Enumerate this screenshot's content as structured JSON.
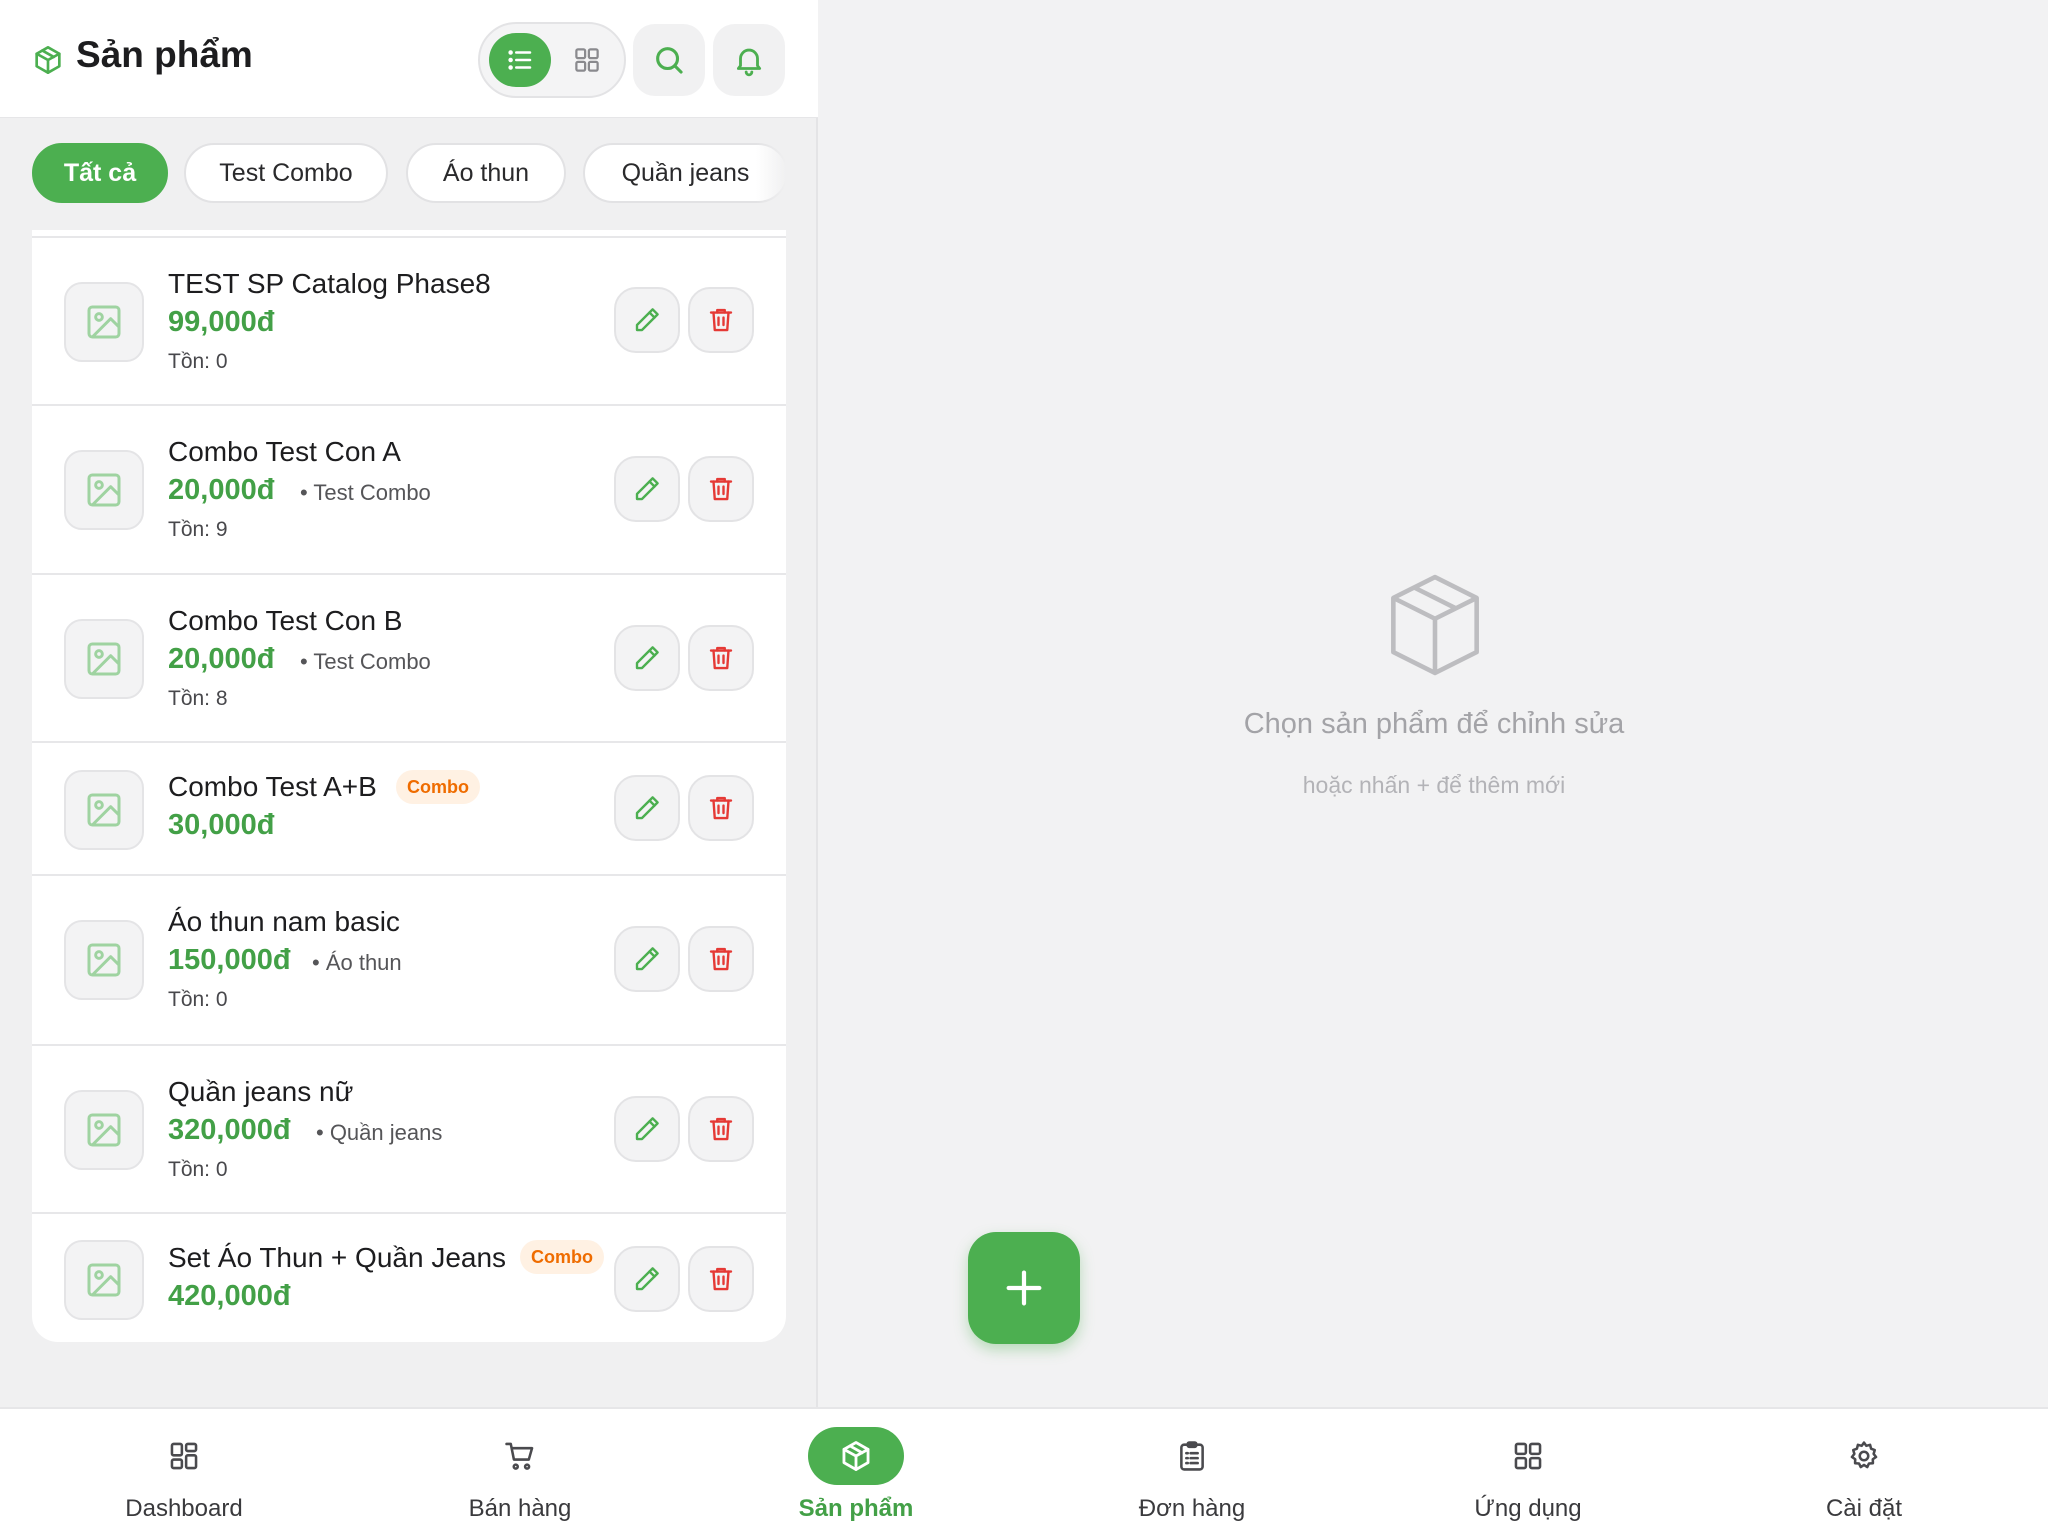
{
  "header": {
    "title": "Sản phẩm",
    "logo_icon": "box-icon",
    "view_list_icon": "list-icon",
    "view_grid_icon": "grid-icon",
    "search_icon": "search-icon",
    "bell_icon": "bell-icon"
  },
  "chips": [
    {
      "label": "Tất cả",
      "active": true
    },
    {
      "label": "Test Combo",
      "active": false
    },
    {
      "label": "Áo thun",
      "active": false
    },
    {
      "label": "Quần jeans",
      "active": false
    }
  ],
  "products": [
    {
      "name": "TEST SP Catalog Phase8",
      "price": "99,000đ",
      "category": "",
      "stock": "Tồn: 0",
      "badge": ""
    },
    {
      "name": "Combo Test Con A",
      "price": "20,000đ",
      "category": "• Test Combo",
      "stock": "Tồn: 9",
      "badge": ""
    },
    {
      "name": "Combo Test Con B",
      "price": "20,000đ",
      "category": "• Test Combo",
      "stock": "Tồn: 8",
      "badge": ""
    },
    {
      "name": "Combo Test A+B",
      "price": "30,000đ",
      "category": "",
      "stock": "",
      "badge": "Combo"
    },
    {
      "name": "Áo thun nam basic",
      "price": "150,000đ",
      "category": "• Áo thun",
      "stock": "Tồn: 0",
      "badge": ""
    },
    {
      "name": "Quần jeans nữ",
      "price": "320,000đ",
      "category": "• Quần jeans",
      "stock": "Tồn: 0",
      "badge": ""
    },
    {
      "name": "Set Áo Thun + Quần Jeans",
      "price": "420,000đ",
      "category": "",
      "stock": "",
      "badge": "Combo"
    }
  ],
  "empty_state": {
    "icon": "box-outline-icon",
    "title": "Chọn sản phẩm để chỉnh sửa",
    "subtitle": "hoặc nhấn + để thêm mới"
  },
  "fab": {
    "icon": "plus-icon"
  },
  "nav": [
    {
      "label": "Dashboard",
      "icon": "dashboard-icon",
      "active": false
    },
    {
      "label": "Bán hàng",
      "icon": "cart-icon",
      "active": false
    },
    {
      "label": "Sản phẩm",
      "icon": "box-icon",
      "active": true
    },
    {
      "label": "Đơn hàng",
      "icon": "clipboard-icon",
      "active": false
    },
    {
      "label": "Ứng dụng",
      "icon": "apps-icon",
      "active": false
    },
    {
      "label": "Cài đặt",
      "icon": "gear-icon",
      "active": false
    }
  ],
  "colors": {
    "accent": "#4caf50",
    "price": "#43a047",
    "delete": "#e53935",
    "badge_bg": "#fff1e3",
    "badge_text": "#ef6c00"
  }
}
